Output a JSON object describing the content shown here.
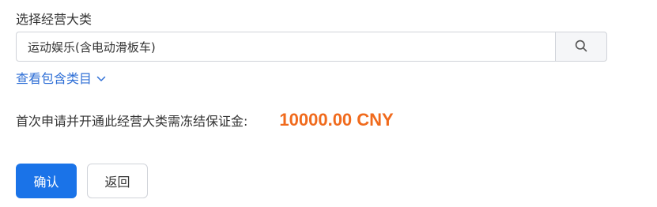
{
  "form": {
    "category_label": "选择经营大类",
    "search": {
      "value": "运动娱乐(含电动滑板车)",
      "placeholder": ""
    },
    "view_categories_link": "查看包含类目",
    "deposit_notice": "首次申请并开通此经营大类需冻结保证金:",
    "deposit_amount": "10000.00 CNY"
  },
  "actions": {
    "confirm_label": "确认",
    "back_label": "返回"
  },
  "icons": {
    "search": "search-icon",
    "chevron": "chevron-down-icon"
  },
  "colors": {
    "primary": "#1a73e8",
    "link": "#2f6fd6",
    "amount": "#f06a1c"
  }
}
